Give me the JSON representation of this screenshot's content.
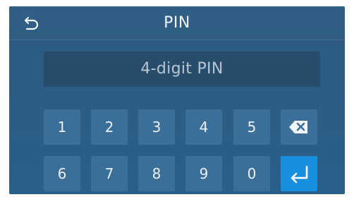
{
  "header": {
    "title": "PIN",
    "back_icon": "back-arrow-icon"
  },
  "pin_field": {
    "placeholder": "4-digit PIN",
    "value": ""
  },
  "keypad": {
    "row1": [
      "1",
      "2",
      "3",
      "4",
      "5"
    ],
    "row2": [
      "6",
      "7",
      "8",
      "9",
      "0"
    ],
    "backspace_icon": "backspace-icon",
    "enter_icon": "enter-icon"
  },
  "colors": {
    "background": "#2c5d84",
    "key": "#3c6f98",
    "enter_key": "#1a8fe0",
    "field": "#284d6c"
  }
}
